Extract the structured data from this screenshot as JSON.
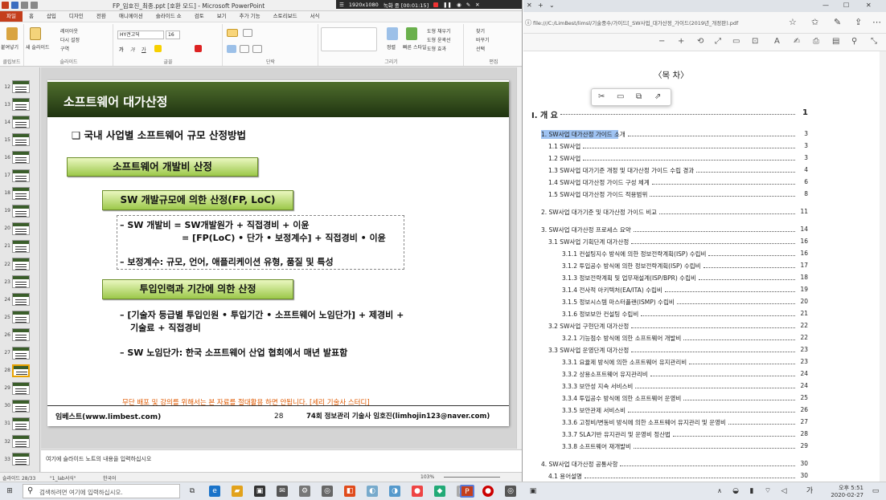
{
  "ppt": {
    "title": "FP_임호진_최종.ppt [호환 모드] - Microsoft PowerPoint",
    "recording": {
      "resolution": "1920x1080",
      "status": "녹화 중 [00:01:15]"
    },
    "tabs": [
      "파일",
      "홈",
      "삽입",
      "디자인",
      "전환",
      "애니메이션",
      "슬라이드 쇼",
      "검토",
      "보기",
      "추가 기능",
      "스토리보드",
      "서식"
    ],
    "ribbon": {
      "clipboard": {
        "label": "클립보드",
        "paste": "붙여넣기"
      },
      "slides": {
        "label": "슬라이드",
        "new": "새 슬라이드",
        "layout": "레이아웃",
        "reset": "다시 설정",
        "section": "구역"
      },
      "font": {
        "label": "글꼴",
        "name": "HY견고딕",
        "size": "16"
      },
      "paragraph": {
        "label": "단락"
      },
      "drawing": {
        "label": "그리기",
        "arrange": "정렬",
        "styles": "빠른 스타일",
        "fill": "도형 채우기",
        "outline": "도형 윤곽선",
        "effect": "도형 효과"
      },
      "editing": {
        "label": "편집",
        "find": "찾기",
        "replace": "바꾸기",
        "select": "선택"
      }
    },
    "thumbs": [
      {
        "n": "12"
      },
      {
        "n": "13"
      },
      {
        "n": "14"
      },
      {
        "n": "15"
      },
      {
        "n": "16"
      },
      {
        "n": "17"
      },
      {
        "n": "18"
      },
      {
        "n": "19"
      },
      {
        "n": "20"
      },
      {
        "n": "21"
      },
      {
        "n": "22"
      },
      {
        "n": "23"
      },
      {
        "n": "24"
      },
      {
        "n": "25"
      },
      {
        "n": "26"
      },
      {
        "n": "27"
      },
      {
        "n": "28"
      },
      {
        "n": "29"
      },
      {
        "n": "30"
      },
      {
        "n": "31"
      },
      {
        "n": "32"
      },
      {
        "n": "33"
      }
    ],
    "slide": {
      "title": "소프트웨어 대가산정",
      "heading": "❑ 국내 사업별 소프트웨어 규모 산정방법",
      "box1": "소프트웨어 개발비 산정",
      "box2": "SW 개발규모에 의한 산정(FP, LoC)",
      "line1": "– SW 개발비 = SW개발원가 + 직접경비 + 이윤",
      "line2": "= [FP(LoC) • 단가 • 보정계수] + 직접경비 • 이윤",
      "line3": "– 보정계수: 규모, 언어, 애플리케이션 유형, 품질 및 특성",
      "box3": "투입인력과 기간에 의한  산정",
      "line4": "– [기술자 등급별 투입인원 • 투입기간 • 소프트웨어 노임단가] + 제경비 +",
      "line5": "기술료 + 직접경비",
      "line6": "– SW 노임단가: 한국 소프트웨어 산업 협회에서 매년 발표함",
      "warning": "무단 배포 및 강의를 위해서는 본 자료를 절대활용 하면 안됩니다. [세리 기술사 스터디]",
      "footer_left": "임베스트(www.limbest.com)",
      "footer_page": "28",
      "footer_right": "74회 정보관리 기술사 임호진(limhojin123@naver.com)"
    },
    "notes_placeholder": "여기에 슬라이드 노트의 내용을 입력하십시오",
    "status": {
      "slide": "슬라이드 28/33",
      "theme": "\"1_lab서식\"",
      "lang": "한국어",
      "zoom": "103%"
    }
  },
  "pdf": {
    "url": "file:///C:/LimBest/limsl/기술중수/가이드[_SW사업_대가산정_가이드(2019년_개정판).pdf",
    "heading": "〈목 차〉",
    "toc": [
      {
        "text": "Ⅰ. 개 요",
        "page": "1",
        "level": 0
      },
      {
        "text": "1. SW사업 대가산정 가이드 소개",
        "page": "3",
        "level": 1,
        "hl": true
      },
      {
        "text": "1.1 SW사업",
        "page": "3",
        "level": 2
      },
      {
        "text": "1.2 SW사업",
        "page": "3",
        "level": 2
      },
      {
        "text": "1.3 SW사업 대가기준 개정 및 대가산정 가이드 수립 경과",
        "page": "4",
        "level": 2
      },
      {
        "text": "1.4 SW사업 대가산정 가이드 구성 체계",
        "page": "6",
        "level": 2
      },
      {
        "text": "1.5 SW사업 대가산정 가이드 적용범위",
        "page": "8",
        "level": 2
      },
      {
        "text": "2. SW사업 대가기준 및 대가산정 가이드 비교",
        "page": "11",
        "level": 1
      },
      {
        "text": "3. SW사업 대가산정 프로세스 요약",
        "page": "14",
        "level": 1
      },
      {
        "text": "3.1 SW사업 기획단계 대가산정",
        "page": "16",
        "level": 2
      },
      {
        "text": "3.1.1 컨설팅지수 방식에 의한 정보전략계획(ISP) 수립비",
        "page": "16",
        "level": 3
      },
      {
        "text": "3.1.2 투입공수 방식에 의한 정보전략계획(ISP) 수립비",
        "page": "17",
        "level": 3
      },
      {
        "text": "3.1.3 정보전략계획 및 업무재설계(ISP/BPR) 수립비",
        "page": "18",
        "level": 3
      },
      {
        "text": "3.1.4 전사적 아키텍처(EA/ITA) 수립비",
        "page": "19",
        "level": 3
      },
      {
        "text": "3.1.5 정보시스템 마스터플랜(ISMP) 수립비",
        "page": "20",
        "level": 3
      },
      {
        "text": "3.1.6 정보보안 컨설팅 수립비",
        "page": "21",
        "level": 3
      },
      {
        "text": "3.2 SW사업 구현단계 대가산정",
        "page": "22",
        "level": 2
      },
      {
        "text": "3.2.1 기능점수 방식에 의한 소프트웨어 개발비",
        "page": "22",
        "level": 3
      },
      {
        "text": "3.3 SW사업 운영단계 대가산정",
        "page": "23",
        "level": 2
      },
      {
        "text": "3.3.1 요율제 방식에 의한 소프트웨어 유지관리비",
        "page": "23",
        "level": 3
      },
      {
        "text": "3.3.2 상용소프트웨어 유지관리비",
        "page": "24",
        "level": 3
      },
      {
        "text": "3.3.3 보안성 지속 서비스비",
        "page": "24",
        "level": 3
      },
      {
        "text": "3.3.4 투입공수 방식에 의한 소프트웨어 운영비",
        "page": "25",
        "level": 3
      },
      {
        "text": "3.3.5 보안관제 서비스비",
        "page": "26",
        "level": 3
      },
      {
        "text": "3.3.6 고정비/변동비 방식에 의한 소프트웨어 유지관리 및 운영비",
        "page": "27",
        "level": 3
      },
      {
        "text": "3.3.7 SLA기반 유지관리 및 운영비 정산법",
        "page": "28",
        "level": 3
      },
      {
        "text": "3.3.8 소프트웨어 재개발비",
        "page": "29",
        "level": 3
      },
      {
        "text": "4. SW사업 대가산정 공통사항",
        "page": "30",
        "level": 1
      },
      {
        "text": "4.1 용어설명",
        "page": "30",
        "level": 2
      }
    ]
  },
  "taskbar": {
    "search_placeholder": "검색하려면 여기에 입력하십시오.",
    "time": "오후 5:51",
    "date": "2020-02-27",
    "ime": "가"
  }
}
